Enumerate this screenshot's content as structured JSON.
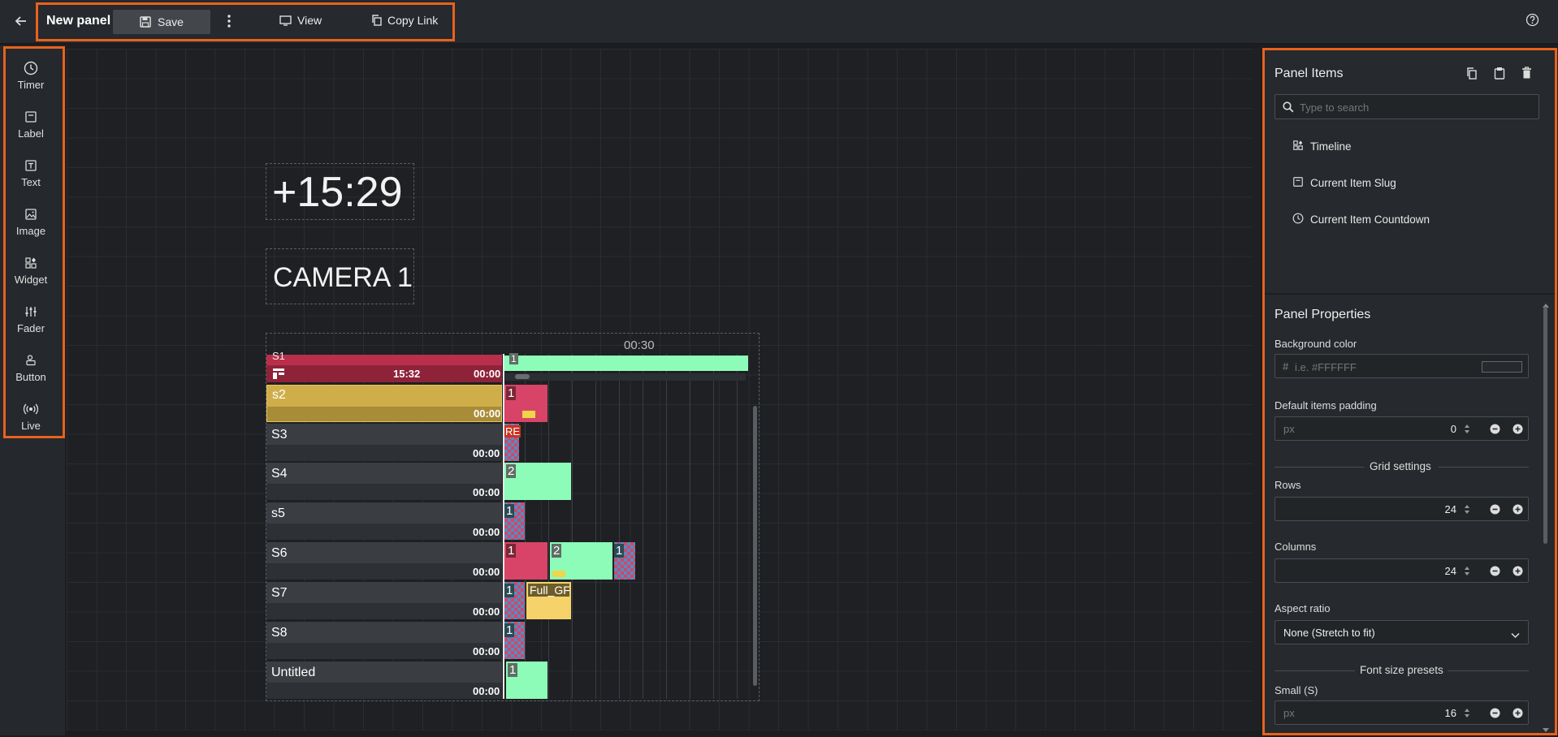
{
  "topbar": {
    "title": "New panel",
    "save_label": "Save",
    "view_label": "View",
    "copy_link_label": "Copy Link"
  },
  "tools": [
    {
      "label": "Timer",
      "icon": "clock-icon"
    },
    {
      "label": "Label",
      "icon": "label-icon"
    },
    {
      "label": "Text",
      "icon": "text-icon"
    },
    {
      "label": "Image",
      "icon": "image-icon"
    },
    {
      "label": "Widget",
      "icon": "widget-icon"
    },
    {
      "label": "Fader",
      "icon": "fader-icon"
    },
    {
      "label": "Button",
      "icon": "button-icon"
    },
    {
      "label": "Live",
      "icon": "live-icon"
    }
  ],
  "canvas": {
    "timer_text": "+15:29",
    "label_text": "CAMERA 1",
    "timeline": {
      "scale_label": "00:30",
      "rows": [
        {
          "name": "S1",
          "duration": "15:32",
          "time": "00:00"
        },
        {
          "name": "s2",
          "time": "00:00"
        },
        {
          "name": "S3",
          "time": "00:00"
        },
        {
          "name": "S4",
          "time": "00:00"
        },
        {
          "name": "s5",
          "time": "00:00"
        },
        {
          "name": "S6",
          "time": "00:00"
        },
        {
          "name": "S7",
          "time": "00:00"
        },
        {
          "name": "S8",
          "time": "00:00"
        },
        {
          "name": "Untitled",
          "time": "00:00"
        }
      ],
      "segment_labels": {
        "one": "1",
        "two": "2",
        "re": "RE",
        "full": "Full_GF"
      }
    }
  },
  "panel_items": {
    "title": "Panel Items",
    "search_placeholder": "Type to search",
    "items": [
      {
        "label": "Timeline",
        "icon": "widget-icon"
      },
      {
        "label": "Current Item Slug",
        "icon": "label-icon"
      },
      {
        "label": "Current Item Countdown",
        "icon": "clock-icon"
      }
    ]
  },
  "panel_properties": {
    "title": "Panel Properties",
    "background_color_label": "Background color",
    "background_color_placeholder": "i.e. #FFFFFF",
    "hash": "#",
    "padding_label": "Default items padding",
    "padding_unit": "px",
    "padding_value": "0",
    "grid_settings_label": "Grid settings",
    "rows_label": "Rows",
    "rows_value": "24",
    "columns_label": "Columns",
    "columns_value": "24",
    "aspect_ratio_label": "Aspect ratio",
    "aspect_ratio_value": "None (Stretch to fit)",
    "font_presets_label": "Font size presets",
    "small_label": "Small (S)",
    "small_unit": "px",
    "small_value": "16"
  },
  "colors": {
    "highlight": "#e8621e",
    "crimson": "#b92f4b",
    "gold": "#cfae4a",
    "mint": "#8dfcb8",
    "pink": "#d84467",
    "teal": "#2ec6d3"
  }
}
